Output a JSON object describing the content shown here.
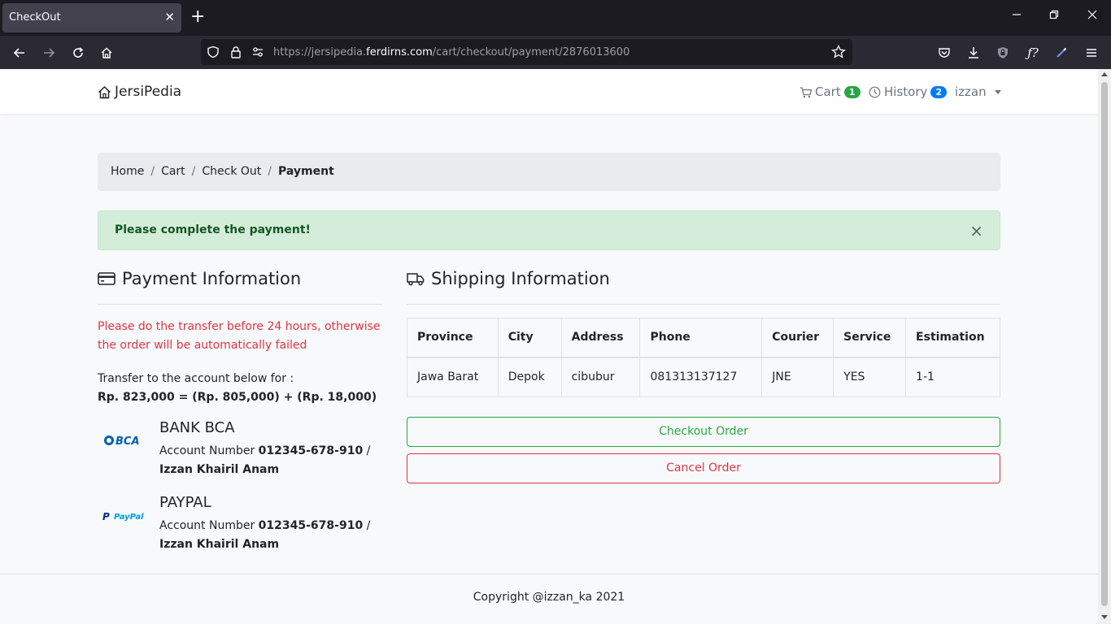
{
  "browser": {
    "tab_title": "CheckOut",
    "url_prefix": "https://jersipedia.",
    "url_domain": "ferdirns.com",
    "url_path": "/cart/checkout/payment/2876013600"
  },
  "site": {
    "brand": "JersiPedia",
    "cart_label": "Cart",
    "cart_count": "1",
    "history_label": "History",
    "history_count": "2",
    "user": "izzan"
  },
  "breadcrumb": {
    "items": [
      "Home",
      "Cart",
      "Check Out"
    ],
    "active": "Payment"
  },
  "alert": {
    "message": "Please complete the payment!",
    "close": "×"
  },
  "payment": {
    "title": "Payment Information",
    "warning": "Please do the transfer before 24 hours, otherwise the order will be automatically failed",
    "transfer_label": "Transfer to the account below for :",
    "amount": "Rp. 823,000 = (Rp. 805,000) + (Rp. 18,000)",
    "banks": [
      {
        "name": "BANK BCA",
        "logo": "BCA",
        "account_label": "Account Number",
        "account_number": "012345-678-910",
        "separator": "/",
        "holder": "Izzan Khairil Anam"
      },
      {
        "name": "PAYPAL",
        "logo": "PayPal",
        "account_label": "Account Number",
        "account_number": "012345-678-910",
        "separator": "/",
        "holder": "Izzan Khairil Anam"
      }
    ]
  },
  "shipping": {
    "title": "Shipping Information",
    "headers": [
      "Province",
      "City",
      "Address",
      "Phone",
      "Courier",
      "Service",
      "Estimation"
    ],
    "row": [
      "Jawa Barat",
      "Depok",
      "cibubur",
      "081313137127",
      "JNE",
      "YES",
      "1-1"
    ]
  },
  "actions": {
    "checkout": "Checkout Order",
    "cancel": "Cancel Order"
  },
  "footer": {
    "copyright": "Copyright @izzan_ka 2021"
  },
  "colors": {
    "success": "#28a745",
    "danger": "#dc3545",
    "primary_badge": "#007bff",
    "alert_bg": "#d4edda"
  }
}
